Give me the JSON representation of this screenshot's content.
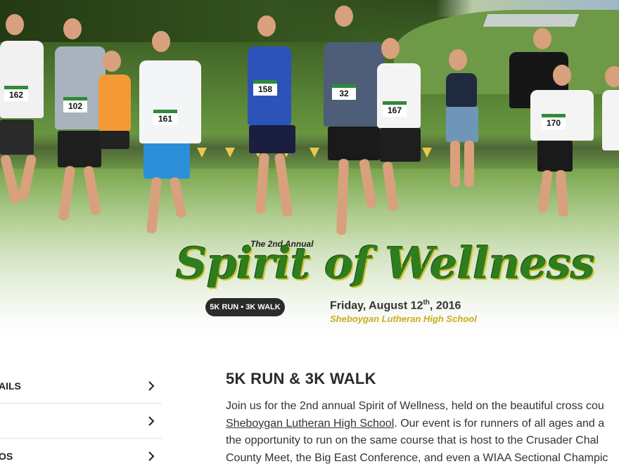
{
  "hero": {
    "bibs": [
      "162",
      "102",
      "161",
      "158",
      "32",
      "167",
      "170"
    ],
    "logo_small": "The 2nd Annual",
    "logo_title": "Spirit of Wellness",
    "pill_label": "5K RUN • 3K WALK",
    "date_main": "Friday, August 12",
    "date_suffix": "th",
    "date_year": ", 2016",
    "venue": "Sheboygan Lutheran High School"
  },
  "sidebar": {
    "items": [
      {
        "label": "AILS"
      },
      {
        "label": ""
      },
      {
        "label": "OS"
      }
    ]
  },
  "main": {
    "heading": "5K RUN & 3K WALK",
    "line1": "Join us for the 2nd annual Spirit of Wellness, held on the beautiful cross cou",
    "link": "Sheboygan Lutheran High School",
    "line2_rest": ". Our event is for runners of all ages and a",
    "line3": "the opportunity to run on the same course that is host to the Crusader Chal",
    "line4": "County Meet, the Big East Conference, and even a WIAA Sectional Champic"
  },
  "colors": {
    "script_green": "#2e7d1f",
    "script_gold": "#d7c233",
    "venue_gold": "#c9ad1c",
    "pill_bg": "#2b2b2b"
  },
  "icons": {
    "chevron": "chevron-right-icon"
  }
}
